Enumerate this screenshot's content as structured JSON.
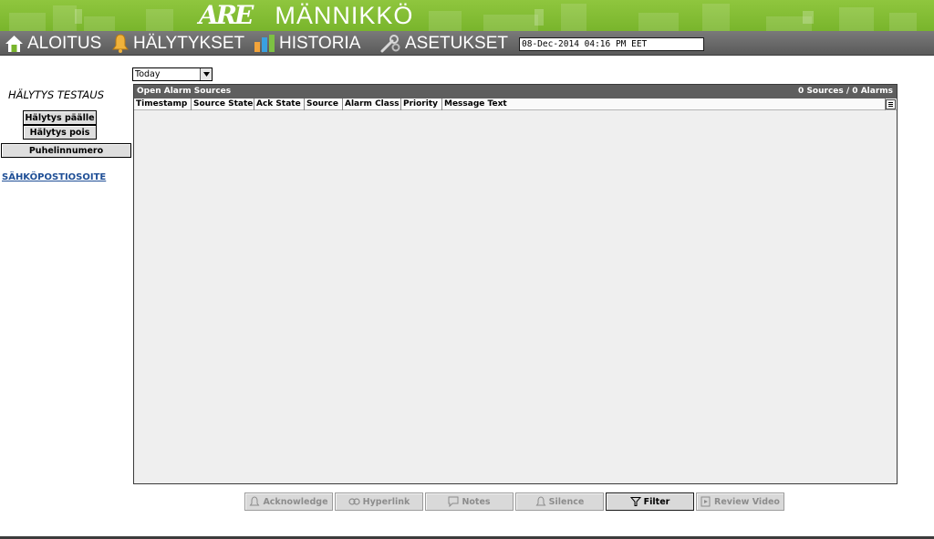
{
  "header": {
    "logo_mark": "ARE",
    "brand_name": "MÄNNIKKÖ"
  },
  "nav": {
    "items": [
      {
        "label": "ALOITUS",
        "icon": "home-icon"
      },
      {
        "label": "HÄLYTYKSET",
        "icon": "bell-icon"
      },
      {
        "label": "HISTORIA",
        "icon": "bar-chart-icon"
      },
      {
        "label": "ASETUKSET",
        "icon": "wrench-gear-icon"
      }
    ],
    "datetime": "08-Dec-2014 04:16 PM EET"
  },
  "sidebar": {
    "title": "HÄLYTYS TESTAUS",
    "buttons": [
      "Hälytys päälle",
      "Hälytys pois",
      "Puhelinnumero"
    ],
    "link": "SÄHKÖPOSTIOSOITE"
  },
  "period_select": {
    "value": "Today"
  },
  "console": {
    "title": "Open Alarm Sources",
    "summary": "0 Sources / 0 Alarms",
    "columns": [
      "Timestamp",
      "Source State",
      "Ack State",
      "Source",
      "Alarm Class",
      "Priority",
      "Message Text"
    ],
    "rows": []
  },
  "actions": [
    {
      "label": "Acknowledge",
      "icon": "acknowledge-icon",
      "enabled": false
    },
    {
      "label": "Hyperlink",
      "icon": "hyperlink-icon",
      "enabled": false
    },
    {
      "label": "Notes",
      "icon": "notes-icon",
      "enabled": false
    },
    {
      "label": "Silence",
      "icon": "silence-icon",
      "enabled": false
    },
    {
      "label": "Filter",
      "icon": "filter-icon",
      "enabled": true
    },
    {
      "label": "Review Video",
      "icon": "review-video-icon",
      "enabled": false
    }
  ],
  "colors": {
    "banner_green": "#86c03a",
    "nav_gray": "#666666",
    "console_header": "#5e5e5e",
    "link_blue": "#1f4f96"
  }
}
